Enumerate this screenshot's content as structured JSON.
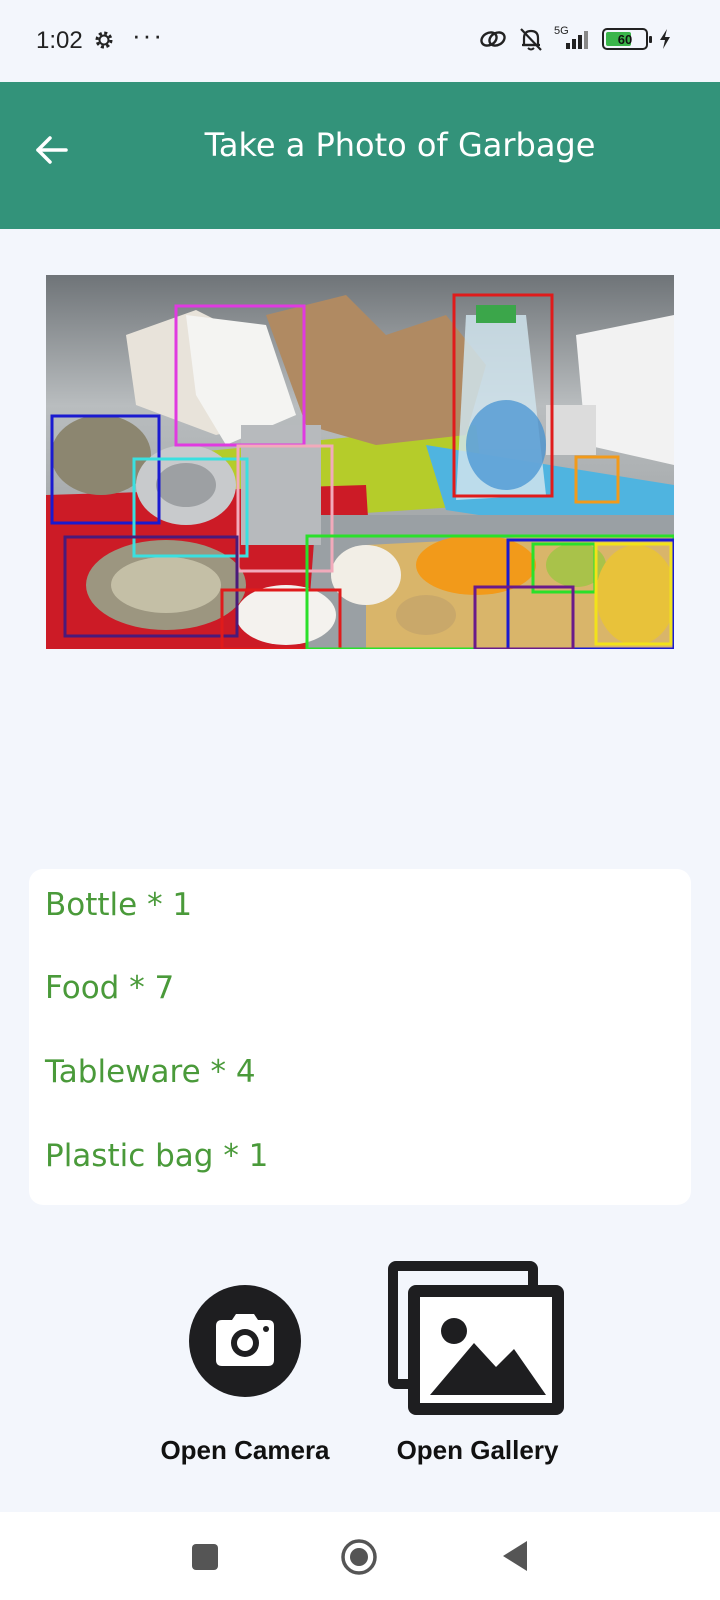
{
  "status_bar": {
    "time": "1:02",
    "more": "···",
    "network": "5G",
    "battery": "60"
  },
  "header": {
    "title": "Take a Photo of Garbage",
    "back_icon": "arrow-left-icon"
  },
  "photo": {
    "description_icon": "detected-garbage-photo"
  },
  "results": {
    "items": [
      "Bottle * 1",
      "Food * 7",
      "Tableware * 4",
      "Plastic bag * 1"
    ]
  },
  "actions": {
    "camera_label": "Open Camera",
    "gallery_label": "Open Gallery",
    "camera_icon": "camera-icon",
    "gallery_icon": "gallery-icon"
  },
  "nav": {
    "recents_icon": "square-icon",
    "home_icon": "home-circle-icon",
    "back_icon": "triangle-back-icon"
  },
  "colors": {
    "app_bar": "#33937a",
    "result_text": "#4a9a3a",
    "background": "#f3f6fc"
  }
}
